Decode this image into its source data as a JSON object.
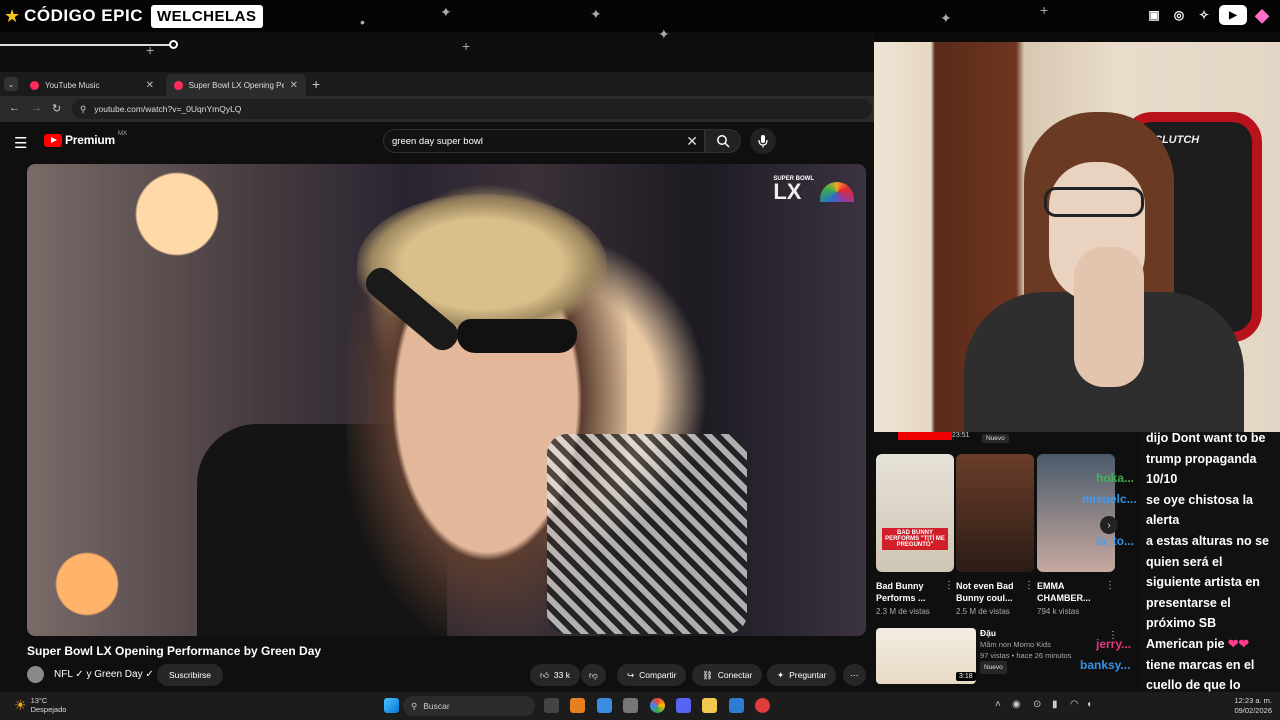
{
  "overlay": {
    "brand": "CÓDIGO EPIC",
    "channel": "WELCHELAS",
    "socials": [
      "twitch-icon",
      "instagram-icon",
      "twitter-icon",
      "youtube-icon",
      "gem-icon"
    ]
  },
  "browser": {
    "tabs": [
      {
        "label": "YouTube Music"
      },
      {
        "label": "Super Bowl LX Opening Perform"
      }
    ],
    "url": "youtube.com/watch?v=_0UqnYmQyLQ"
  },
  "youtube": {
    "logo": "Premium",
    "logo_country": "MX",
    "search_query": "green day super bowl",
    "video": {
      "badge_small": "SUPER BOWL",
      "badge_big": "LX",
      "title": "Super Bowl LX Opening Performance by Green Day",
      "channel": "NFL ✓ y Green Day ✓",
      "subscribe": "Suscribirse",
      "likes": "33 k",
      "share": "Compartir",
      "connect": "Conectar",
      "ask": "Preguntar"
    },
    "sidebar": {
      "top_duration": "23:51",
      "top_badge": "Nuevo",
      "shorts": [
        {
          "title": "Bad Bunny Performs ...",
          "views": "2.3 M de vistas",
          "caption": "BAD BUNNY PERFORMS \"TITÍ ME PREGUNTÓ\""
        },
        {
          "title": "Not even Bad Bunny coul...",
          "views": "2.5 M de vistas"
        },
        {
          "title": "EMMA CHAMBER...",
          "views": "794 k vistas"
        }
      ],
      "rec": {
        "title": "Đậu",
        "channel": "Mầm non Momo Kids",
        "meta": "97 vistas • hace 26 minutos",
        "badge": "Nuevo",
        "duration": "3:18"
      }
    }
  },
  "chat_overlay_names": [
    "hoka...",
    "misuelc...",
    "ia_to...",
    "jerry...",
    "banksy..."
  ],
  "chat": {
    "lines": [
      "dijo Dont want to be",
      "trump propaganda",
      "10/10",
      "se oye chistosa la",
      "alerta",
      "a estas alturas no se",
      "quien será el",
      "siguiente artista en",
      "presentarse el",
      "próximo SB",
      "American pie",
      "tiene marcas en el",
      "cuello de que lo",
      "ahorcaron"
    ]
  },
  "taskbar": {
    "temp": "13°C",
    "weather": "Despejado",
    "search": "Buscar",
    "time": "12:23 a. m.",
    "date": "09/02/2026"
  }
}
